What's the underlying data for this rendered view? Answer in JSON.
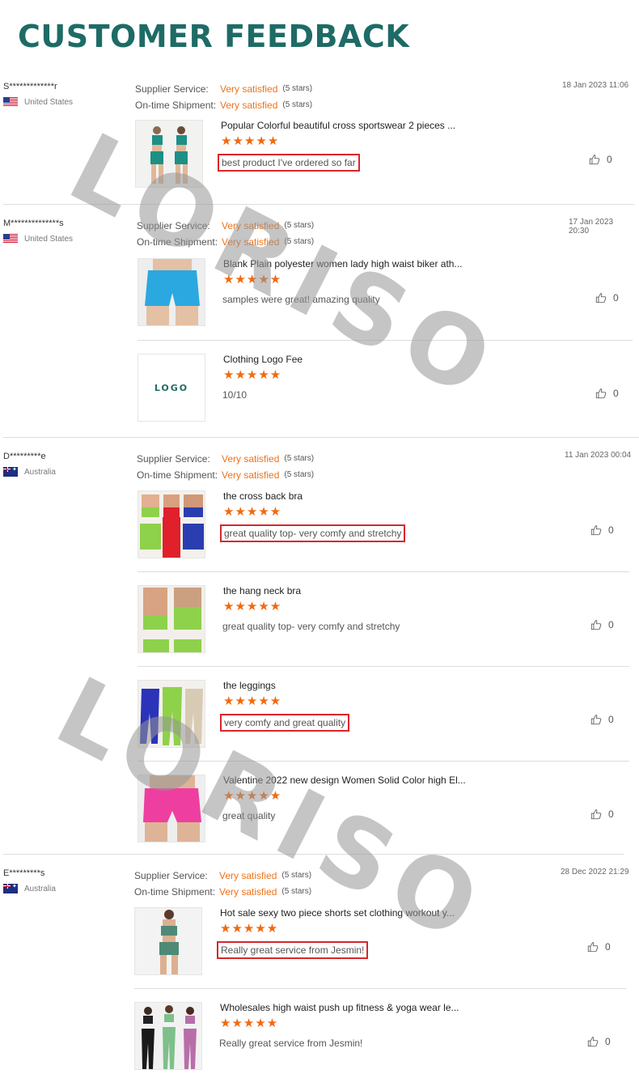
{
  "page": {
    "title": "CUSTOMER FEEDBACK",
    "watermark": "LORISO"
  },
  "colors": {
    "title": "#1e6b66",
    "accent_orange": "#f07218",
    "stars": "#ef6a0f",
    "highlight_border": "#d9262c"
  },
  "rating_labels": {
    "supplier": "Supplier Service:",
    "shipment": "On-time Shipment:"
  },
  "reviews": [
    {
      "reviewer": "S*************r",
      "country": "United States",
      "flag": "us-flag",
      "supplier_rating": "Very satisfied",
      "supplier_stars": "(5 stars)",
      "shipment_rating": "Very satisfied",
      "shipment_stars": "(5 stars)",
      "date": "18 Jan 2023 11:06",
      "items": [
        {
          "title": "Popular Colorful beautiful cross sportswear 2 pieces ...",
          "stars": "★★★★★",
          "comment": "best product I've ordered so far",
          "highlighted": true,
          "likes": "0",
          "image": "teal-sportswear-set"
        }
      ]
    },
    {
      "reviewer": "M**************s",
      "country": "United States",
      "flag": "us-flag",
      "supplier_rating": "Very satisfied",
      "supplier_stars": "(5 stars)",
      "shipment_rating": "Very satisfied",
      "shipment_stars": "(5 stars)",
      "date": "17 Jan 2023 20:30",
      "items": [
        {
          "title": "Blank Plain polyester women lady high waist biker ath...",
          "stars": "★★★★★",
          "comment": "samples were great! amazing quality",
          "highlighted": false,
          "likes": "0",
          "image": "blue-biker-shorts"
        },
        {
          "title": "Clothing Logo Fee",
          "stars": "★★★★★",
          "comment": "10/10",
          "highlighted": false,
          "likes": "0",
          "image": "logo-tile",
          "image_text": "LOGO"
        }
      ]
    },
    {
      "reviewer": "D*********e",
      "country": "Australia",
      "flag": "au-flag",
      "supplier_rating": "Very satisfied",
      "supplier_stars": "(5 stars)",
      "shipment_rating": "Very satisfied",
      "shipment_stars": "(5 stars)",
      "date": "11 Jan 2023 00:04",
      "items": [
        {
          "title": "the cross back bra",
          "stars": "★★★★★",
          "comment": "great quality top- very comfy and stretchy",
          "highlighted": true,
          "likes": "0",
          "image": "cross-back-bra"
        },
        {
          "title": "the hang neck bra",
          "stars": "★★★★★",
          "comment": "great quality top- very comfy and stretchy",
          "highlighted": false,
          "likes": "0",
          "image": "hang-neck-bra"
        },
        {
          "title": "the leggings",
          "stars": "★★★★★",
          "comment": "very comfy and great quality",
          "highlighted": true,
          "likes": "0",
          "image": "leggings"
        },
        {
          "title": "Valentine 2022 new design Women Solid Color high El...",
          "stars": "★★★★★",
          "comment": "great quality",
          "highlighted": false,
          "likes": "0",
          "image": "pink-shorts"
        }
      ]
    },
    {
      "reviewer": "E*********s",
      "country": "Australia",
      "flag": "au-flag",
      "supplier_rating": "Very satisfied",
      "supplier_stars": "(5 stars)",
      "shipment_rating": "Very satisfied",
      "shipment_stars": "(5 stars)",
      "date": "28 Dec 2022 21:29",
      "items": [
        {
          "title": "Hot sale sexy two piece shorts set clothing workout y...",
          "stars": "★★★★★",
          "comment": "Really great service from Jesmin!",
          "highlighted": true,
          "likes": "0",
          "image": "green-shorts-set"
        },
        {
          "title": "Wholesales high waist push up fitness & yoga wear le...",
          "stars": "★★★★★",
          "comment": "Really great service from Jesmin!",
          "highlighted": false,
          "likes": "0",
          "image": "yoga-leggings-group"
        }
      ]
    }
  ]
}
